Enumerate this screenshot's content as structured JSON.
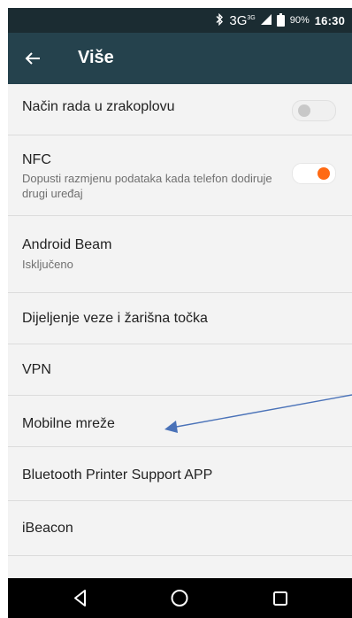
{
  "status_bar": {
    "bluetooth_icon": "bluetooth-icon",
    "network_label": "3G",
    "network_superscript": "3G",
    "battery_percent": "90%",
    "time": "16:30"
  },
  "toolbar": {
    "back_icon": "arrow-left-icon",
    "title": "Više"
  },
  "settings": {
    "items": [
      {
        "title": "Način rada u zrakoplovu",
        "subtitle": "",
        "toggle": "off"
      },
      {
        "title": "NFC",
        "subtitle": "Dopusti razmjenu podataka kada telefon dodiruje drugi uređaj",
        "toggle": "on"
      },
      {
        "title": "Android Beam",
        "subtitle": "Isključeno"
      },
      {
        "title": "Dijeljenje veze i žarišna točka",
        "subtitle": ""
      },
      {
        "title": "VPN",
        "subtitle": ""
      },
      {
        "title": "Mobilne mreže",
        "subtitle": ""
      },
      {
        "title": "Bluetooth Printer Support APP",
        "subtitle": ""
      },
      {
        "title": "iBeacon",
        "subtitle": ""
      }
    ]
  },
  "annotation": {
    "type": "arrow",
    "color": "#4a72b8",
    "points_to": "Mobilne mreže"
  },
  "nav_bar": {
    "back_icon": "triangle-back-icon",
    "home_icon": "circle-home-icon",
    "recent_icon": "square-recent-icon"
  },
  "colors": {
    "status_bar": "#1b2c32",
    "toolbar": "#25424d",
    "accent": "#ff6a13",
    "background": "#f3f3f3"
  }
}
